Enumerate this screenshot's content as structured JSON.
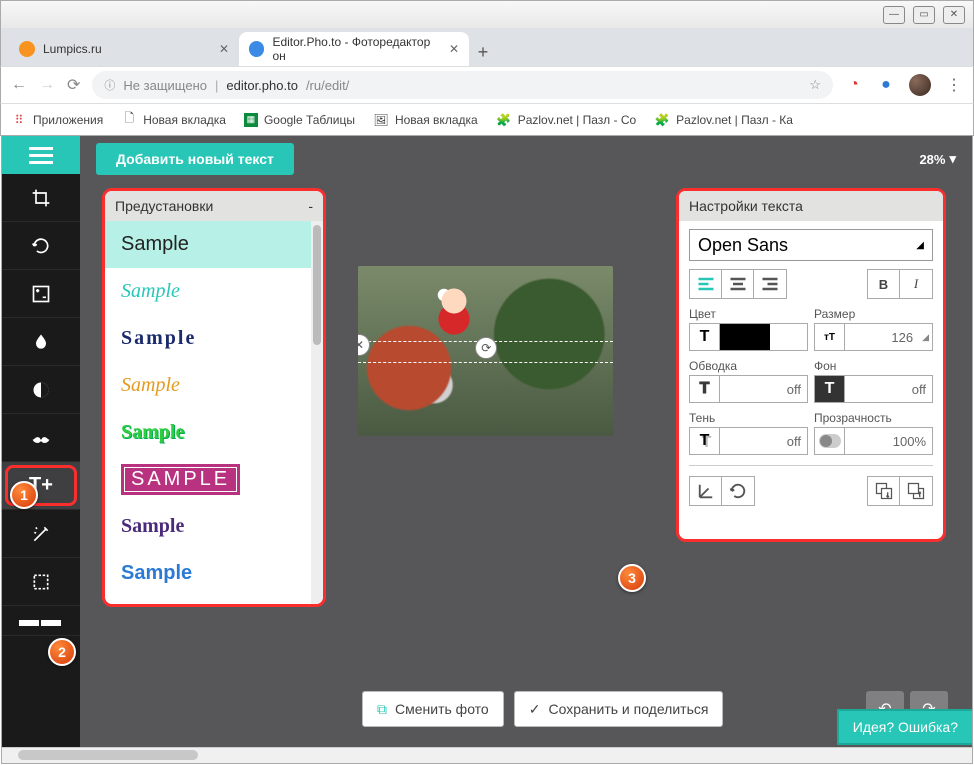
{
  "window": {
    "minimize": "—",
    "maximize": "▭",
    "close": "✕"
  },
  "tabs": [
    {
      "title": "Lumpics.ru",
      "favicon_color": "#f7931e"
    },
    {
      "title": "Editor.Pho.to - Фоторедактор он",
      "favicon_color": "#3b8ae6"
    }
  ],
  "new_tab": "+",
  "address": {
    "secure_label": "Не защищено",
    "host": "editor.pho.to",
    "path": "/ru/edit/"
  },
  "bookmarks": [
    {
      "label": "Приложения",
      "icon": "apps"
    },
    {
      "label": "Новая вкладка",
      "icon": "page"
    },
    {
      "label": "Google Таблицы",
      "icon": "sheets"
    },
    {
      "label": "Новая вкладка",
      "icon": "img"
    },
    {
      "label": "Pazlov.net | Пазл - Со",
      "icon": "puzzle"
    },
    {
      "label": "Pazlov.net | Пазл - Ка",
      "icon": "puzzle"
    }
  ],
  "app": {
    "add_text_button": "Добавить новый текст",
    "zoom": "28%",
    "presets_header": "Предустановки",
    "presets_collapse": "-",
    "presets": [
      {
        "label": "Sample",
        "style": "font-family:'Segoe UI',sans-serif;color:#222;"
      },
      {
        "label": "Sample",
        "style": "font-family:'Brush Script MT',cursive;color:#27c6b6;font-style:italic;"
      },
      {
        "label": "Sample",
        "style": "font-family:Georgia,serif;color:#1a2a6c;font-weight:bold;letter-spacing:2px;"
      },
      {
        "label": "Sample",
        "style": "font-family:'Brush Script MT',cursive;color:#e59a1f;font-style:italic;"
      },
      {
        "label": "Sample",
        "style": "font-family:'Comic Sans MS',cursive;color:#2ecc40;font-weight:bold;text-shadow:1px 1px 0 #0a5;"
      },
      {
        "label": "SAMPLE",
        "style": "font-family:Arial;background:#b83280;color:#fff;padding:2px 8px;letter-spacing:3px;border:2px solid #b83280;outline:1px solid #fff;outline-offset:-4px;"
      },
      {
        "label": "Sample",
        "style": "font-family:Georgia,serif;color:#4a2a7a;font-weight:bold;"
      },
      {
        "label": "Sample",
        "style": "font-family:Arial;color:#2a7ad6;font-weight:bold;"
      }
    ],
    "settings": {
      "header": "Настройки текста",
      "font": "Open Sans",
      "align_left": "left",
      "align_center": "center",
      "align_right": "right",
      "bold": "B",
      "italic": "I",
      "color_label": "Цвет",
      "size_label": "Размер",
      "size_value": "126",
      "stroke_label": "Обводка",
      "stroke_value": "off",
      "bg_label": "Фон",
      "bg_value": "off",
      "shadow_label": "Тень",
      "shadow_value": "off",
      "opacity_label": "Прозрачность",
      "opacity_value": "100%"
    },
    "change_photo": "Сменить фото",
    "save_share": "Сохранить и поделиться",
    "feedback": "Идея? Ошибка?"
  },
  "markers": {
    "m1": "1",
    "m2": "2",
    "m3": "3"
  }
}
